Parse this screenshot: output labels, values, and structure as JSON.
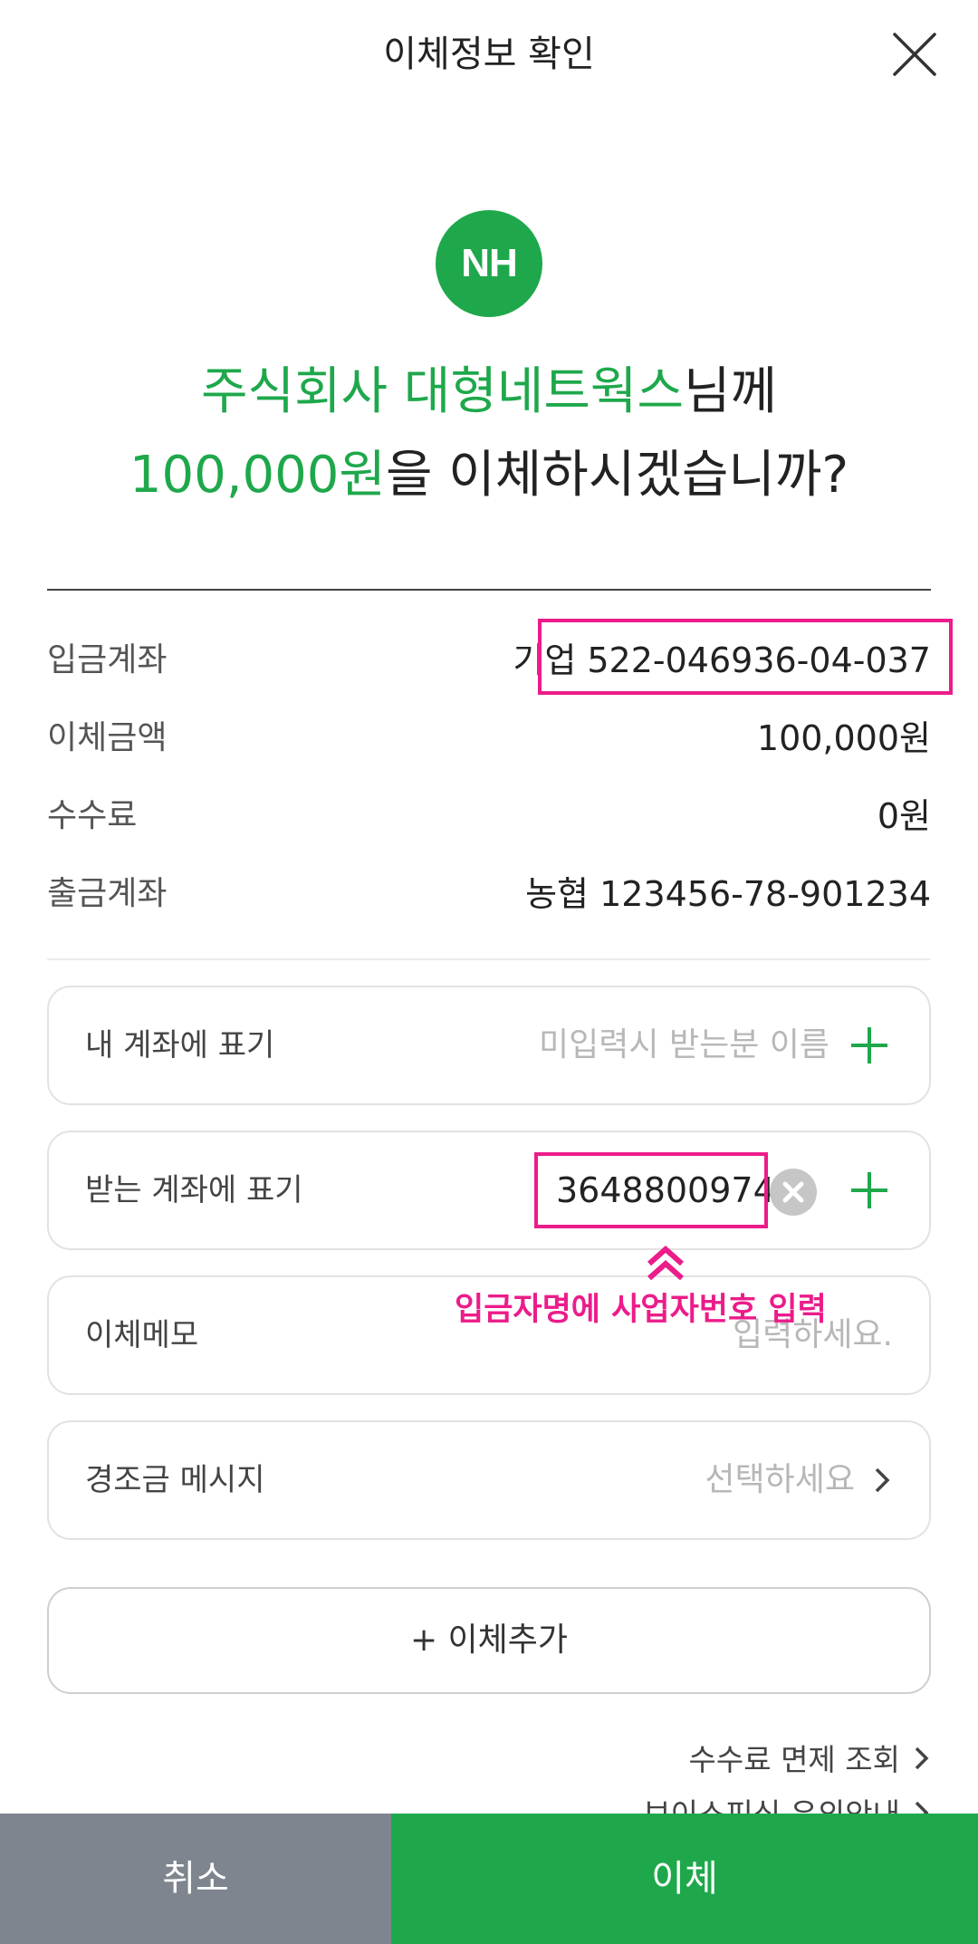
{
  "header": {
    "title": "이체정보 확인"
  },
  "logo": {
    "text": "NH"
  },
  "headline": {
    "recipient": "주식회사 대형네트웍스",
    "recipient_suffix": "님께",
    "amount": "100,000원",
    "amount_suffix": "을 이체하시겠습니까?"
  },
  "info": [
    {
      "label": "입금계좌",
      "value": "기업 522-046936-04-037"
    },
    {
      "label": "이체금액",
      "value": "100,000원"
    },
    {
      "label": "수수료",
      "value": "0원"
    },
    {
      "label": "출금계좌",
      "value": "농협 123456-78-901234"
    }
  ],
  "fields": {
    "my_account_memo": {
      "label": "내 계좌에 표기",
      "placeholder": "미입력시 받는분 이름"
    },
    "recipient_account_memo": {
      "label": "받는 계좌에 표기",
      "value": "3648800974"
    },
    "transfer_memo": {
      "label": "이체메모",
      "placeholder": "입력하세요."
    },
    "event_message": {
      "label": "경조금 메시지",
      "placeholder": "선택하세요"
    }
  },
  "annotation": {
    "text": "입금자명에 사업자번호 입력"
  },
  "add_transfer": {
    "label": "+ 이체추가"
  },
  "links": {
    "fee_waiver": "수수료 면제 조회",
    "security": "보이스피싱 유의안내"
  },
  "buttons": {
    "cancel": "취소",
    "confirm": "이체"
  },
  "colors": {
    "brand_green": "#1ea84b",
    "annotation_pink": "#ec1c8a",
    "cancel_gray": "#7e858e"
  }
}
